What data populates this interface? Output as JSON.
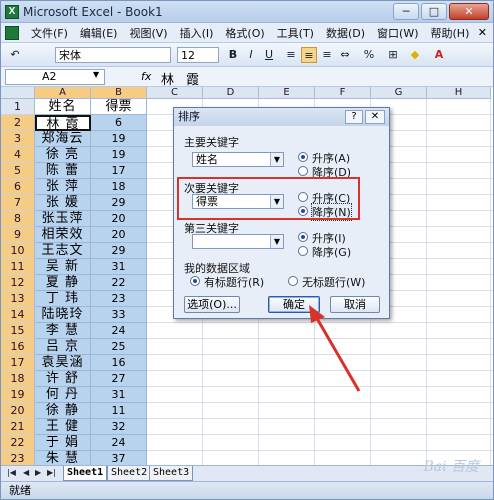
{
  "window": {
    "title": "Microsoft Excel - Book1",
    "min": "─",
    "max": "□",
    "close": "✕"
  },
  "menu": [
    "文件(F)",
    "编辑(E)",
    "视图(V)",
    "插入(I)",
    "格式(O)",
    "工具(T)",
    "数据(D)",
    "窗口(W)",
    "帮助(H)"
  ],
  "menu_close": "✕",
  "toolbar": {
    "font": "宋体",
    "size": "12",
    "bold": "B",
    "italic": "I",
    "underline": "U"
  },
  "formula": {
    "cell_ref": "A2",
    "fx": "fx",
    "content": "林 霞"
  },
  "columns": [
    "A",
    "B",
    "C",
    "D",
    "E",
    "F",
    "G",
    "H"
  ],
  "table": {
    "header_name": "姓名",
    "header_score": "得票",
    "rows": [
      {
        "row": "1",
        "name": "姓名",
        "score": "得票"
      },
      {
        "row": "2",
        "name": "林 霞",
        "score": "6"
      },
      {
        "row": "3",
        "name": "郑海云",
        "score": "19"
      },
      {
        "row": "4",
        "name": "徐 亮",
        "score": "19"
      },
      {
        "row": "5",
        "name": "陈 蕾",
        "score": "17"
      },
      {
        "row": "6",
        "name": "张 萍",
        "score": "18"
      },
      {
        "row": "7",
        "name": "张 媛",
        "score": "29"
      },
      {
        "row": "8",
        "name": "张玉萍",
        "score": "20"
      },
      {
        "row": "9",
        "name": "相荣效",
        "score": "20"
      },
      {
        "row": "10",
        "name": "王志文",
        "score": "29"
      },
      {
        "row": "11",
        "name": "吴 新",
        "score": "31"
      },
      {
        "row": "12",
        "name": "夏 静",
        "score": "22"
      },
      {
        "row": "13",
        "name": "丁 玮",
        "score": "23"
      },
      {
        "row": "14",
        "name": "陆晓玲",
        "score": "33"
      },
      {
        "row": "15",
        "name": "李 慧",
        "score": "24"
      },
      {
        "row": "16",
        "name": "吕 京",
        "score": "25"
      },
      {
        "row": "17",
        "name": "袁昊涵",
        "score": "16"
      },
      {
        "row": "18",
        "name": "许 舒",
        "score": "27"
      },
      {
        "row": "19",
        "name": "何 丹",
        "score": "31"
      },
      {
        "row": "20",
        "name": "徐 静",
        "score": "11"
      },
      {
        "row": "21",
        "name": "王 健",
        "score": "32"
      },
      {
        "row": "22",
        "name": "于 娟",
        "score": "24"
      },
      {
        "row": "23",
        "name": "朱 慧",
        "score": "37"
      }
    ]
  },
  "sheets": [
    "Sheet1",
    "Sheet2",
    "Sheet3"
  ],
  "status": "就绪",
  "watermark": "Bai 百度",
  "dialog": {
    "title": "排序",
    "help": "?",
    "close": "✕",
    "primary_label": "主要关键字",
    "primary_value": "姓名",
    "secondary_label": "次要关键字",
    "secondary_value": "得票",
    "third_label": "第三关键字",
    "third_value": "",
    "asc": "升序(A)",
    "desc": "降序(D)",
    "asc2": "升序(C)",
    "desc2": "降序(N)",
    "asc3": "升序(I)",
    "desc3": "降序(G)",
    "range_label": "我的数据区域",
    "has_header": "有标题行(R)",
    "no_header": "无标题行(W)",
    "options_btn": "选项(O)...",
    "ok_btn": "确定",
    "cancel_btn": "取消"
  },
  "colors": {
    "selection": "#b8d3ee",
    "highlight": "#d8322c",
    "arrow": "#d8322c"
  }
}
